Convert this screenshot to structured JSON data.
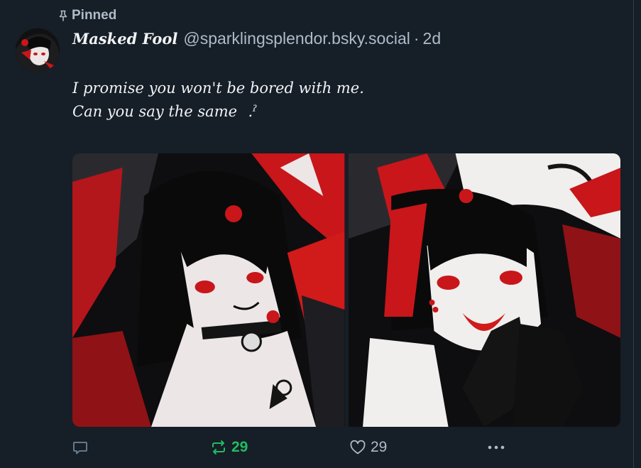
{
  "pinned_label": "Pinned",
  "author": {
    "display_name": "Masked Fool",
    "handle": "@sparklingsplendor.bsky.social",
    "separator": "·",
    "time": "2d"
  },
  "post": {
    "lines": [
      "I promise you won't be bored with me.",
      "Can you say the same   .ˀ"
    ]
  },
  "images": [
    {
      "alt": "anime character artwork in red, black and white, left"
    },
    {
      "alt": "anime character artwork in red, black and white, right"
    }
  ],
  "actions": {
    "reply_count": "",
    "repost_count": "29",
    "like_count": "29"
  },
  "icons": {
    "pin": "pin-icon",
    "reply": "reply-icon",
    "repost": "repost-icon",
    "like": "heart-icon",
    "more": "more-icon"
  },
  "colors": {
    "background": "#161e27",
    "muted_text": "#aebbc9",
    "repost_active": "#20bc62",
    "accent_red": "#d11a1a"
  }
}
